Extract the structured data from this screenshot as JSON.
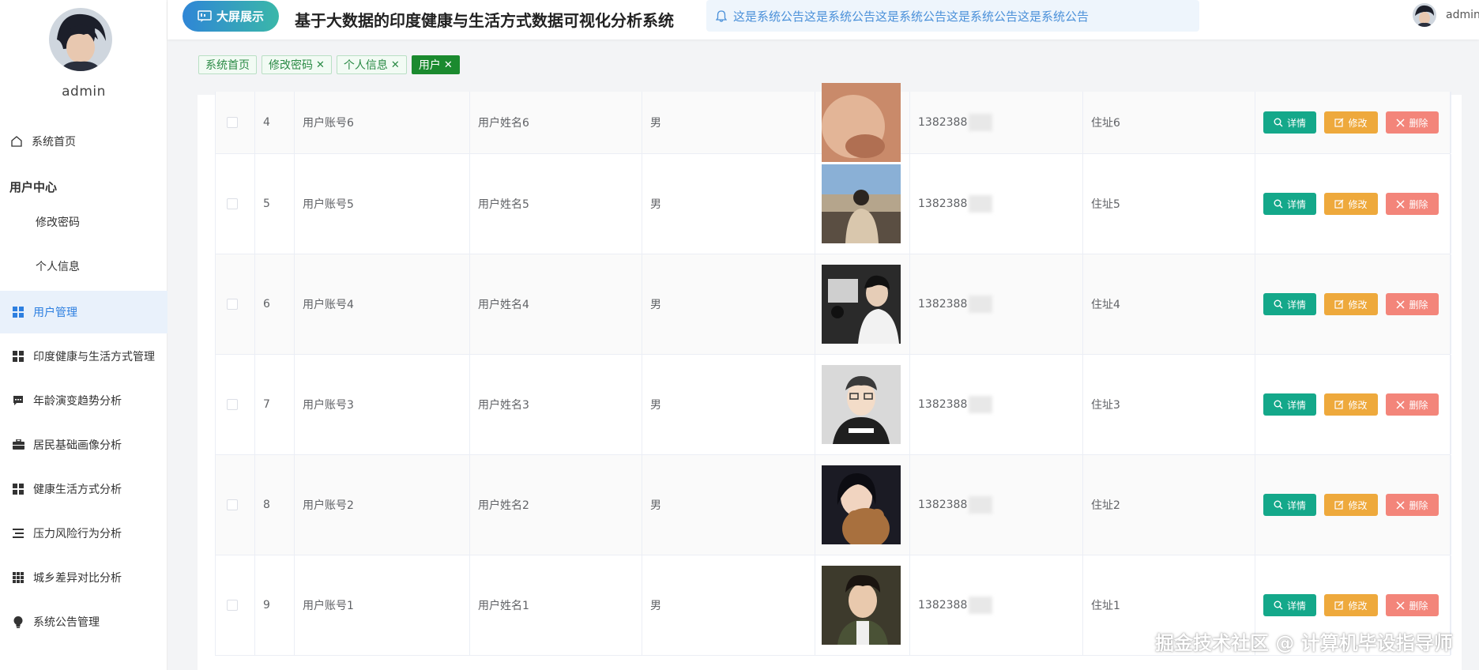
{
  "sidebar": {
    "username": "admin",
    "items": [
      {
        "label": "系统首页",
        "icon": "home-icon"
      },
      {
        "label": "修改密码",
        "icon": ""
      },
      {
        "label": "个人信息",
        "icon": ""
      },
      {
        "label": "用户管理",
        "icon": "grid-icon",
        "active": true
      },
      {
        "label": "印度健康与生活方式管理",
        "icon": "grid-icon"
      },
      {
        "label": "年龄演变趋势分析",
        "icon": "chat-icon"
      },
      {
        "label": "居民基础画像分析",
        "icon": "briefcase-icon"
      },
      {
        "label": "健康生活方式分析",
        "icon": "grid-icon"
      },
      {
        "label": "压力风险行为分析",
        "icon": "list-icon"
      },
      {
        "label": "城乡差异对比分析",
        "icon": "apps-icon"
      },
      {
        "label": "系统公告管理",
        "icon": "bulb-icon"
      }
    ],
    "group_label": "用户中心"
  },
  "header": {
    "bigscreen_label": "大屏展示",
    "title": "基于大数据的印度健康与生活方式数据可视化分析系统",
    "notice": "这是系统公告这是系统公告这是系统公告这是系统公告这是系统公告",
    "user": "admin"
  },
  "tags": [
    {
      "label": "系统首页",
      "closable": false
    },
    {
      "label": "修改密码",
      "closable": true
    },
    {
      "label": "个人信息",
      "closable": true
    },
    {
      "label": "用户",
      "closable": true,
      "active": true
    }
  ],
  "table": {
    "rows": [
      {
        "index": "4",
        "account": "用户账号6",
        "name": "用户姓名6",
        "gender": "男",
        "phone": "1382388",
        "address": "住址6"
      },
      {
        "index": "5",
        "account": "用户账号5",
        "name": "用户姓名5",
        "gender": "男",
        "phone": "1382388",
        "address": "住址5"
      },
      {
        "index": "6",
        "account": "用户账号4",
        "name": "用户姓名4",
        "gender": "男",
        "phone": "1382388",
        "address": "住址4"
      },
      {
        "index": "7",
        "account": "用户账号3",
        "name": "用户姓名3",
        "gender": "男",
        "phone": "1382388",
        "address": "住址3"
      },
      {
        "index": "8",
        "account": "用户账号2",
        "name": "用户姓名2",
        "gender": "男",
        "phone": "1382388",
        "address": "住址2"
      },
      {
        "index": "9",
        "account": "用户账号1",
        "name": "用户姓名1",
        "gender": "男",
        "phone": "1382388",
        "address": "住址1"
      }
    ],
    "actions": {
      "detail": "详情",
      "edit": "修改",
      "delete": "删除"
    }
  },
  "watermark": "掘金技术社区 @ 计算机毕设指导师",
  "colors": {
    "primary": "#2d7fe0",
    "detail": "#14a88a",
    "edit": "#eea93c",
    "delete": "#f3857a",
    "tag_active": "#1b8a2f"
  }
}
